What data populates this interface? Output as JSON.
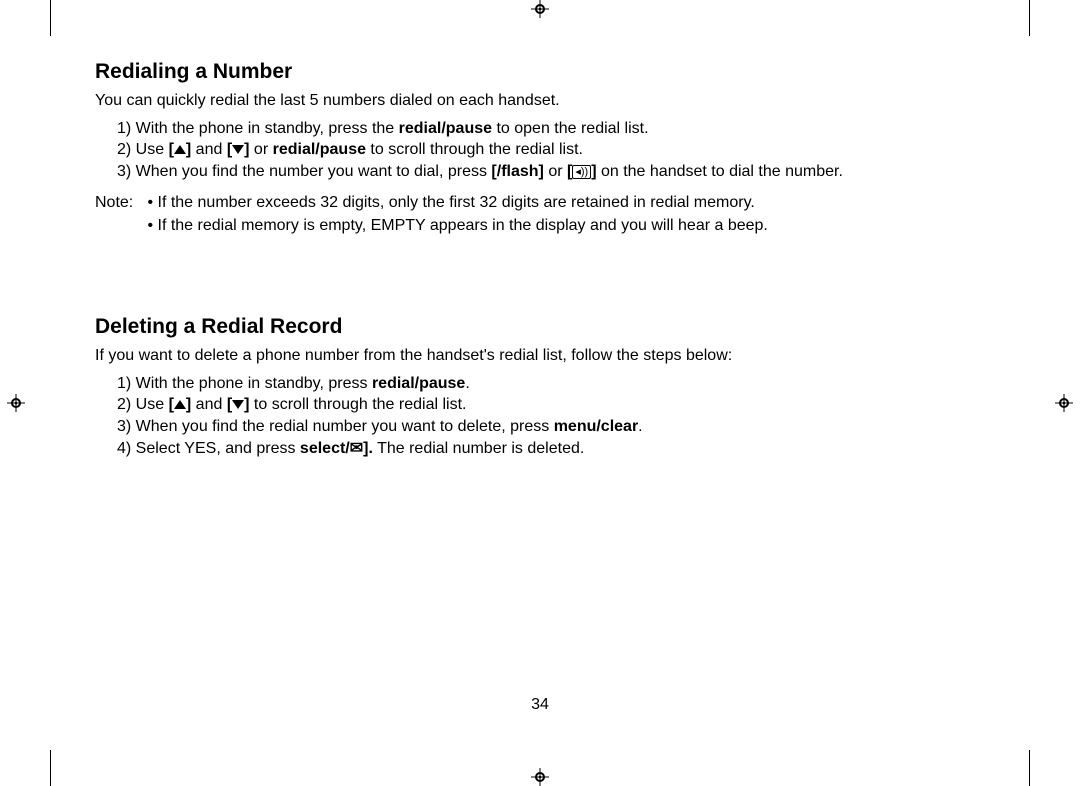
{
  "page_number": "34",
  "section1": {
    "heading": "Redialing a Number",
    "intro": "You can quickly redial the last 5 numbers dialed on each handset.",
    "step1_pre": "1) With the phone in standby, press the ",
    "redial_pause": "redial/pause",
    "step1_post": " to open the redial list.",
    "step2_pre": "2) Use ",
    "and_word": " and ",
    "or_word": " or ",
    "step2_post": " to scroll through the redial list.",
    "step3_pre": "3) When you find the number you want to dial, press ",
    "flash": "/flash]",
    "or_word2": " or ",
    "step3_post": " on the handset to dial the number.",
    "note_label": "Note:",
    "note1": "• If the number exceeds 32 digits, only the first 32 digits are retained in redial memory.",
    "note2": "• If the redial memory is empty, EMPTY appears in the display and you will hear a beep."
  },
  "section2": {
    "heading": "Deleting a Redial Record",
    "intro": "If you want to delete a phone number from the handset's redial list, follow the steps below:",
    "step1_pre": "1) With the phone in standby, press ",
    "redial_pause": "redial/pause",
    "step1_post": ".",
    "step2_pre": "2) Use ",
    "and_word": " and ",
    "step2_post": " to scroll through the redial list.",
    "step3_pre": "3) When you find the redial number you want to delete, press ",
    "menu_clear": "menu/clear",
    "step3_post": ".",
    "step4_pre": "4) Select YES, and press ",
    "select_mail": "select/",
    "step4_post": " The redial number is deleted."
  },
  "icons": {
    "up": "▲",
    "down": "▼",
    "speaker": "◂))",
    "mail": "✉",
    "phone": "["
  }
}
